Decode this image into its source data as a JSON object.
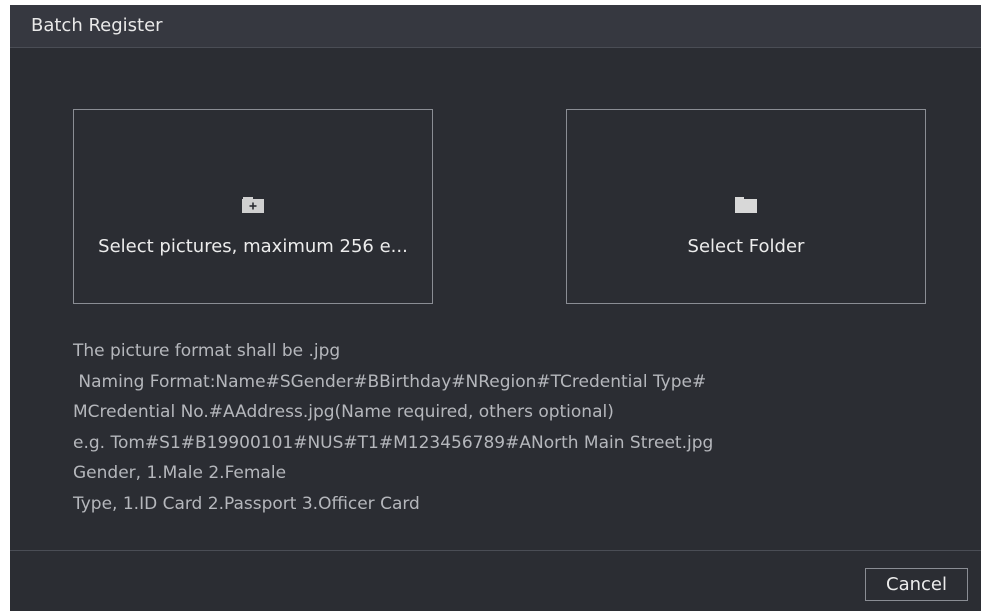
{
  "dialog": {
    "title": "Batch Register"
  },
  "select_pictures": {
    "icon": "folder-add-icon",
    "label": "Select pictures, maximum 256 e..."
  },
  "select_folder": {
    "icon": "folder-icon",
    "label": "Select Folder"
  },
  "info_lines": [
    "The picture format shall be .jpg",
    " Naming Format:Name#SGender#BBirthday#NRegion#TCredential Type#",
    "MCredential No.#AAddress.jpg(Name required, others optional)",
    "e.g. Tom#S1#B19900101#NUS#T1#M123456789#ANorth Main Street.jpg",
    "Gender, 1.Male 2.Female",
    "Type, 1.ID Card 2.Passport 3.Officer Card"
  ],
  "footer": {
    "cancel_label": "Cancel"
  },
  "colors": {
    "background": "#2b2d33",
    "titlebar": "#363840",
    "border": "#8a8d94",
    "text": "#ececec",
    "info_text": "#b5b7bc"
  }
}
